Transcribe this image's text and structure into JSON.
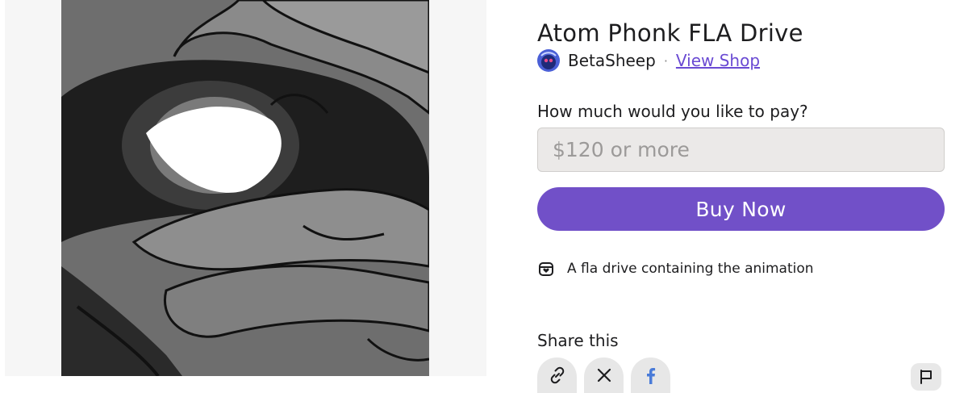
{
  "product": {
    "title": "Atom Phonk FLA Drive",
    "description": "A fla drive containing the animation"
  },
  "creator": {
    "name": "BetaSheep",
    "separator": "·",
    "view_shop_label": "View Shop"
  },
  "purchase": {
    "pay_label": "How much would you like to pay?",
    "price_placeholder": "$120 or more",
    "price_value": "",
    "buy_label": "Buy Now"
  },
  "share": {
    "label": "Share this",
    "buttons": [
      {
        "icon": "link-icon",
        "name": "copy-link-button"
      },
      {
        "icon": "x-icon",
        "name": "share-x-button"
      },
      {
        "icon": "facebook-icon",
        "name": "share-facebook-button"
      }
    ]
  },
  "report": {
    "icon": "flag-icon"
  },
  "colors": {
    "accent": "#7150c8",
    "link": "#6a4ad3",
    "facebook": "#4a7bd8"
  }
}
